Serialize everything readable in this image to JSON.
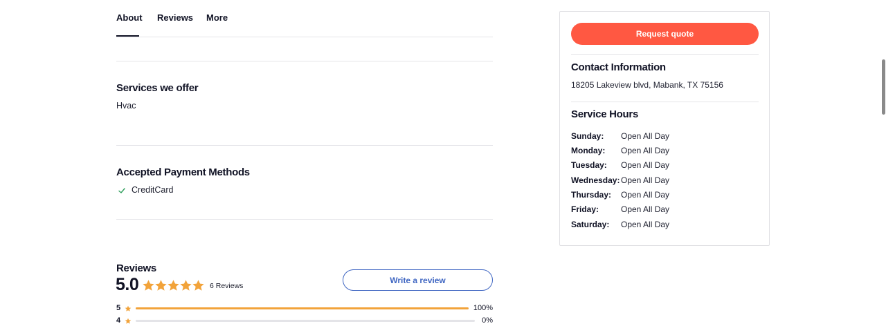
{
  "tabs": [
    {
      "label": "About"
    },
    {
      "label": "Reviews"
    },
    {
      "label": "More"
    }
  ],
  "services": {
    "title": "Services we offer",
    "items": [
      "Hvac"
    ]
  },
  "payment": {
    "title": "Accepted Payment Methods",
    "items": [
      "CreditCard"
    ]
  },
  "reviews": {
    "title": "Reviews",
    "rating": "5.0",
    "stars": 5,
    "count_label": "6 Reviews",
    "write_label": "Write a review",
    "distribution": [
      {
        "stars": "5",
        "percent_label": "100%",
        "fraction": 1.0
      },
      {
        "stars": "4",
        "percent_label": "0%",
        "fraction": 0.0
      }
    ]
  },
  "sidebar": {
    "quote_label": "Request quote",
    "contact_title": "Contact Information",
    "address": "18205 Lakeview blvd, Mabank, TX 75156",
    "hours_title": "Service Hours",
    "hours": [
      {
        "day": "Sunday:",
        "value": "Open All Day"
      },
      {
        "day": "Monday:",
        "value": "Open All Day"
      },
      {
        "day": "Tuesday:",
        "value": "Open All Day"
      },
      {
        "day": "Wednesday:",
        "value": "Open All Day"
      },
      {
        "day": "Thursday:",
        "value": "Open All Day"
      },
      {
        "day": "Friday:",
        "value": "Open All Day"
      },
      {
        "day": "Saturday:",
        "value": "Open All Day"
      }
    ]
  },
  "colors": {
    "primary_button": "#ff5842",
    "star": "#f2a33a",
    "link_blue": "#3f66c2",
    "check_green": "#2e9e5b"
  },
  "icons": {
    "check": "check-icon",
    "star": "star-icon"
  }
}
